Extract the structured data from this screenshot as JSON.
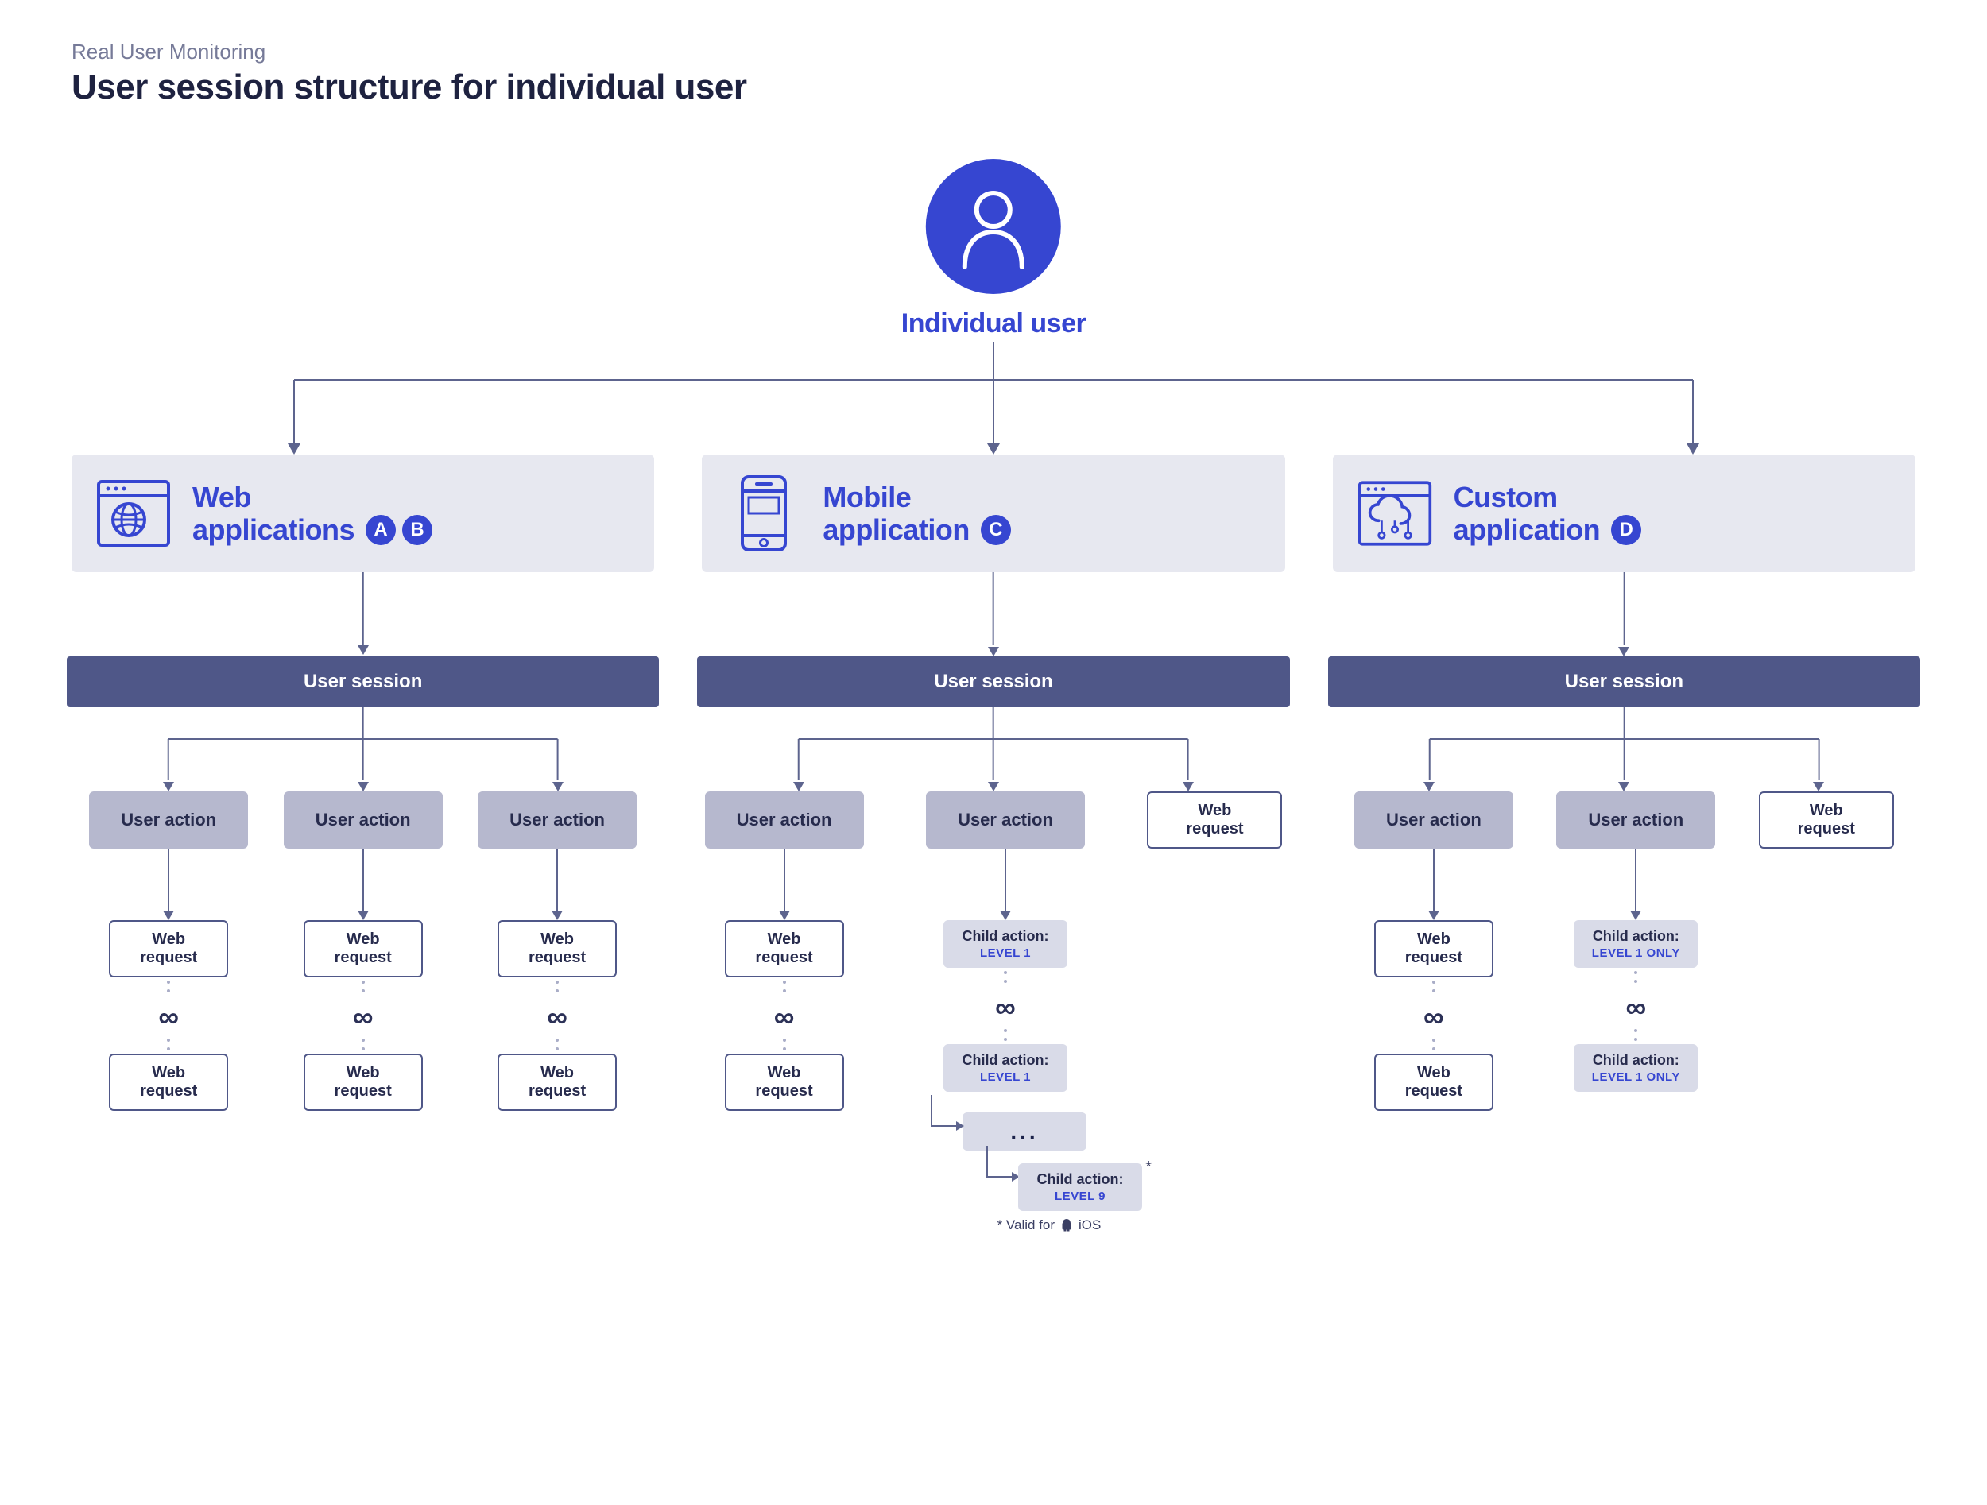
{
  "header": {
    "eyebrow": "Real User Monitoring",
    "title": "User session structure for individual user"
  },
  "root": {
    "label": "Individual user",
    "icon": "user-icon"
  },
  "columns": [
    {
      "key": "web",
      "icon": "globe-browser-icon",
      "title_line1": "Web",
      "title_line2": "applications",
      "badges": [
        "A",
        "B"
      ],
      "session_label": "User session",
      "branches": [
        {
          "action": "User action",
          "requests": [
            "Web request",
            "Web request"
          ],
          "infinity": "∞"
        },
        {
          "action": "User action",
          "requests": [
            "Web request",
            "Web request"
          ],
          "infinity": "∞"
        },
        {
          "action": "User action",
          "requests": [
            "Web request",
            "Web request"
          ],
          "infinity": "∞"
        }
      ]
    },
    {
      "key": "mobile",
      "icon": "mobile-device-icon",
      "title_line1": "Mobile",
      "title_line2": "application",
      "badges": [
        "C"
      ],
      "session_label": "User session",
      "branches": [
        {
          "action": "User action",
          "requests": [
            "Web request",
            "Web request"
          ],
          "infinity": "∞"
        },
        {
          "action": "User action",
          "child_top": {
            "label": "Child action:",
            "level": "LEVEL 1"
          },
          "infinity": "∞",
          "cascade": [
            {
              "label": "Child action:",
              "level": "LEVEL 1"
            },
            {
              "ellipsis": "..."
            },
            {
              "label": "Child action:",
              "level": "LEVEL 9",
              "starred": true
            }
          ]
        },
        {
          "web_request_only": "Web request"
        }
      ],
      "footnote": {
        "text_before": "* Valid for",
        "platforms": [
          "android-icon",
          "ios-label"
        ],
        "ios_text": "iOS"
      }
    },
    {
      "key": "custom",
      "icon": "cloud-custom-icon",
      "title_line1": "Custom",
      "title_line2": "application",
      "badges": [
        "D"
      ],
      "session_label": "User session",
      "branches": [
        {
          "action": "User action",
          "requests": [
            "Web request",
            "Web request"
          ],
          "infinity": "∞"
        },
        {
          "action": "User action",
          "child_top": {
            "label": "Child action:",
            "level": "LEVEL 1 ONLY"
          },
          "infinity": "∞",
          "child_bottom": {
            "label": "Child action:",
            "level": "LEVEL 1 ONLY"
          }
        },
        {
          "web_request_only": "Web request"
        }
      ]
    }
  ],
  "colors": {
    "primary": "#3646d1",
    "dark_slate": "#4f5788",
    "light_bg": "#e7e8f0",
    "mid_bg": "#b6b8ce"
  }
}
